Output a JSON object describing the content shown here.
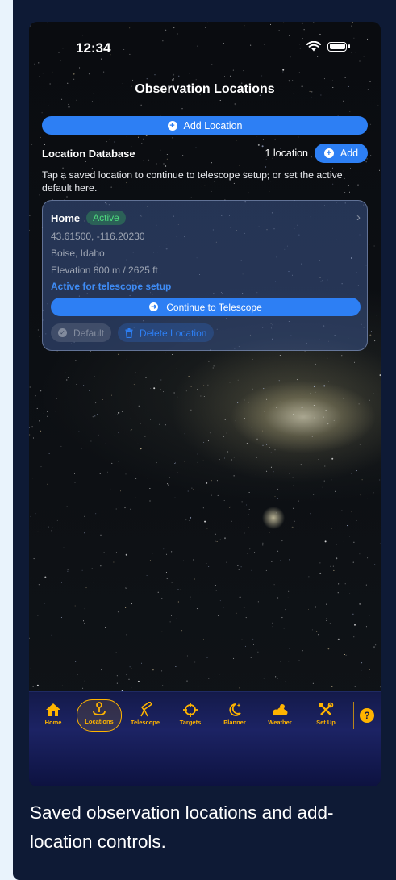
{
  "status": {
    "time": "12:34"
  },
  "header": {
    "title": "Observation Locations"
  },
  "actions": {
    "add_location_label": "Add Location"
  },
  "database": {
    "title": "Location Database",
    "count": "1 location",
    "add_label": "Add",
    "help": "Tap a saved location to continue to telescope setup, or set the active default here."
  },
  "location": {
    "name": "Home",
    "badge": "Active",
    "coords": "43.61500, -116.20230",
    "place": "Boise, Idaho",
    "elevation": "Elevation 800 m / 2625 ft",
    "active_note": "Active for telescope setup",
    "continue_label": "Continue to Telescope",
    "default_label": "Default",
    "delete_label": "Delete Location"
  },
  "tabs": [
    {
      "label": "Home",
      "icon": "home-icon"
    },
    {
      "label": "Locations",
      "icon": "location-pin-icon",
      "selected": true
    },
    {
      "label": "Telescope",
      "icon": "telescope-icon"
    },
    {
      "label": "Targets",
      "icon": "crosshair-icon"
    },
    {
      "label": "Planner",
      "icon": "moon-star-icon"
    },
    {
      "label": "Weather",
      "icon": "cloud-sun-icon"
    },
    {
      "label": "Set Up",
      "icon": "tools-icon"
    }
  ],
  "help_button": {
    "label": "?"
  },
  "caption": "Saved observation locations and add-location controls.",
  "colors": {
    "accent": "#2d7ff4",
    "tab_accent": "#ffb400",
    "active_green": "#4fdc7f"
  }
}
